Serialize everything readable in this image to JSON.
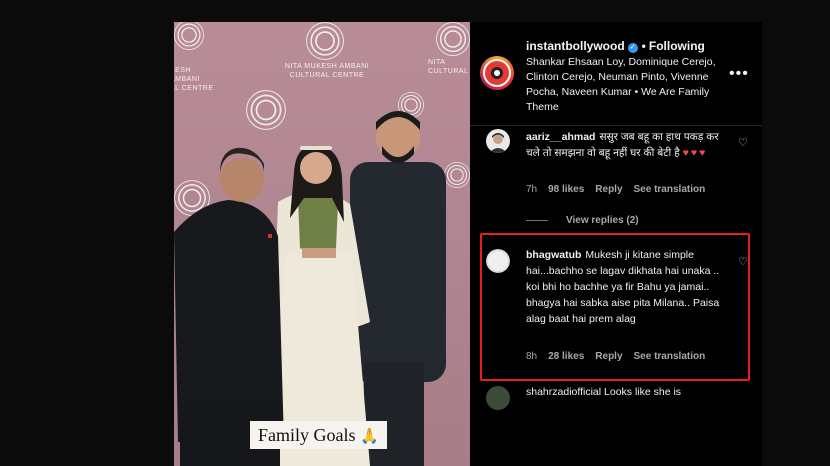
{
  "media": {
    "brand_lines": [
      "NITA MUKESH AMBANI",
      "CULTURAL CENTRE"
    ],
    "brand_fragment_left": [
      "KESH AMBANI",
      "AL CENTRE"
    ],
    "brand_fragment_right": [
      "NITA",
      "MUKESH",
      "CULTURAL"
    ],
    "caption_text": "Family Goals",
    "caption_emoji": "🙏"
  },
  "post_header": {
    "username": "instantbollywood",
    "verified_glyph": "✓",
    "separator": "•",
    "follow_status": "Following",
    "description": "Shankar Ehsaan Loy, Dominique Cerejo, Clinton Cerejo, Neuman Pinto, Vivenne Pocha, Naveen Kumar • We Are Family Theme",
    "more_glyph": "•••"
  },
  "comments": [
    {
      "username": "aariz__ahmad",
      "text": "ससुर जब बहू का हाथ पकड़ कर चले तो समझना वो बहू नहीं घर की बेटी है",
      "hearts": "♥♥♥",
      "time": "7h",
      "likes": "98 likes",
      "reply_label": "Reply",
      "translate_label": "See translation",
      "like_icon": "♡"
    },
    {
      "username": "bhagwatub",
      "text": "Mukesh ji kitane simple hai...bachho se lagav dikhata hai unaka .. koi bhi ho bachhe ya fir Bahu ya jamai.. bhagya hai sabka aise pita Milana.. Paisa alag baat hai prem alag",
      "time": "8h",
      "likes": "28 likes",
      "reply_label": "Reply",
      "translate_label": "See translation",
      "like_icon": "♡"
    }
  ],
  "view_replies": "View replies (2)",
  "partial_comment": "shahrzadiofficial Looks like she is",
  "colors": {
    "highlight": "#e51e1e",
    "verified": "#3897f0",
    "heart_red": "#ed4956",
    "backdrop": "#b08690"
  }
}
